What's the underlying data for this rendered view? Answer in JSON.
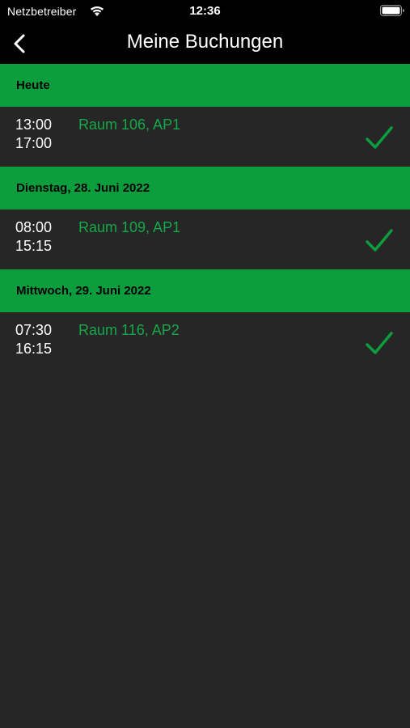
{
  "status_bar": {
    "carrier": "Netzbetreiber",
    "time": "12:36"
  },
  "nav": {
    "title": "Meine Buchungen"
  },
  "colors": {
    "accent_green": "#0c9d3d",
    "room_text_green": "#15a848",
    "background": "#262626"
  },
  "sections": [
    {
      "header": "Heute",
      "bookings": [
        {
          "start": "13:00",
          "end": "17:00",
          "room": "Raum 106, AP1",
          "status_icon": "checkmark-icon"
        }
      ]
    },
    {
      "header": "Dienstag, 28. Juni 2022",
      "bookings": [
        {
          "start": "08:00",
          "end": "15:15",
          "room": "Raum 109, AP1",
          "status_icon": "checkmark-icon"
        }
      ]
    },
    {
      "header": "Mittwoch, 29. Juni 2022",
      "bookings": [
        {
          "start": "07:30",
          "end": "16:15",
          "room": "Raum 116, AP2",
          "status_icon": "checkmark-icon"
        }
      ]
    }
  ]
}
